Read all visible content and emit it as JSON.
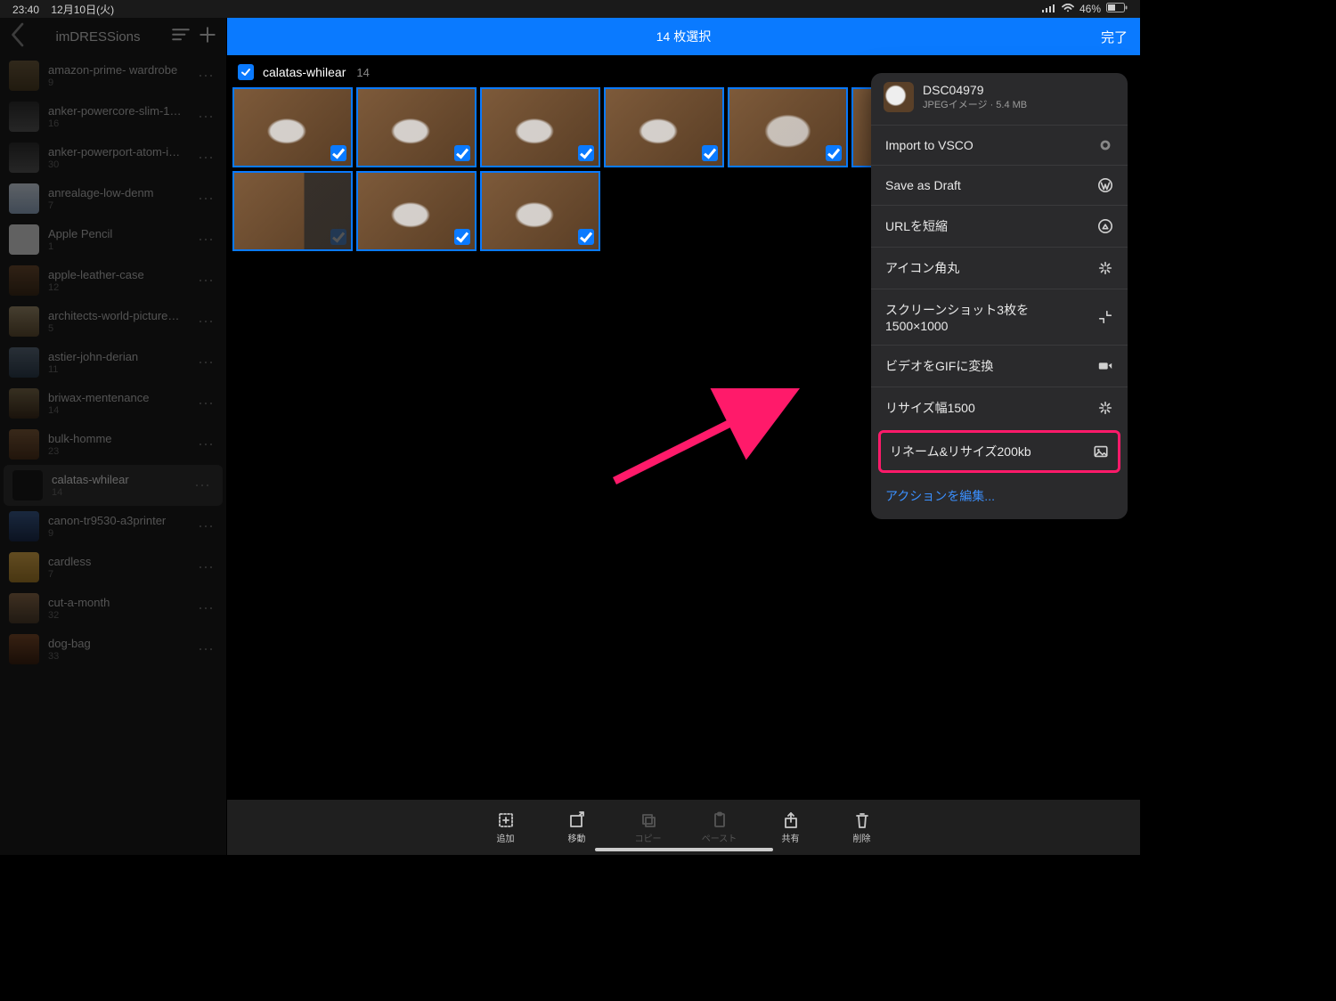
{
  "statusbar": {
    "time": "23:40",
    "date": "12月10日(火)",
    "battery": "46%"
  },
  "sidebar": {
    "title": "imDRESSions",
    "albums": [
      {
        "name": "amazon-prime- wardrobe",
        "count": "9"
      },
      {
        "name": "anker-powercore-slim-1000...",
        "count": "16"
      },
      {
        "name": "anker-powerport-atom-iii-s...",
        "count": "30"
      },
      {
        "name": "anrealage-low-denm",
        "count": "7"
      },
      {
        "name": "Apple Pencil",
        "count": "1"
      },
      {
        "name": "apple-leather-case",
        "count": "12"
      },
      {
        "name": "architects-world-picture-bo...",
        "count": "5"
      },
      {
        "name": "astier-john-derian",
        "count": "11"
      },
      {
        "name": "briwax-mentenance",
        "count": "14"
      },
      {
        "name": "bulk-homme",
        "count": "23"
      },
      {
        "name": "calatas-whilear",
        "count": "14"
      },
      {
        "name": "canon-tr9530-a3printer",
        "count": "9"
      },
      {
        "name": "cardless",
        "count": "7"
      },
      {
        "name": "cut-a-month",
        "count": "32"
      },
      {
        "name": "dog-bag",
        "count": "33"
      }
    ]
  },
  "main": {
    "title": "14 枚選択",
    "done": "完了",
    "section": "calatas-whilear",
    "badge": "14"
  },
  "toolbar": {
    "add": "追加",
    "move": "移動",
    "copy": "コピー",
    "paste": "ペースト",
    "share": "共有",
    "delete": "削除"
  },
  "sheet": {
    "file_title": "DSC04979",
    "file_sub": "JPEGイメージ · 5.4 MB",
    "rows": {
      "import": "Import to VSCO",
      "draft": "Save as Draft",
      "shorten": "URLを短縮",
      "round": "アイコン角丸",
      "shot": "スクリーンショット3枚を1500×1000",
      "gif": "ビデオをGIFに変換",
      "resize": "リサイズ幅1500",
      "rename": "リネーム&リサイズ200kb"
    },
    "edit": "アクションを編集..."
  }
}
